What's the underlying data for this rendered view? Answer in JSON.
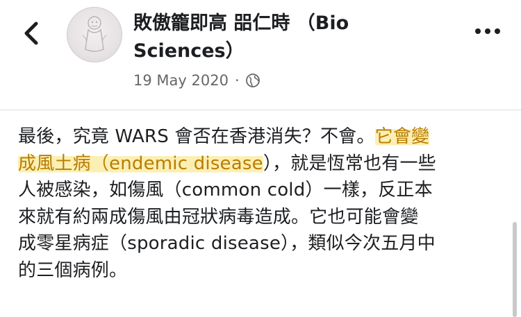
{
  "header": {
    "author_line1": "敗傲籠即高 㗊仁時 （Bio",
    "author_line2": "Sciences）",
    "date": "19 May 2020",
    "separator": "·",
    "back_icon": "chevron-left-icon",
    "globe_icon": "globe-icon",
    "more_icon": "more-horizontal-icon"
  },
  "post": {
    "line1_plain": "最後，究竟 WARS 會否在香港消失？不會。",
    "line1_highlight": "它會變",
    "line2_highlight": "成風土病（endemic disease",
    "line2_plain": "），就是恆常也有一些",
    "line3": "人被感染，如傷風（common cold）一樣，反正本",
    "line4": "來就有約兩成傷風由冠狀病毒造成。它也可能會變",
    "line5": "成零星病症（sporadic disease），類似今次五月中",
    "line6": "的三個病例。"
  },
  "colors": {
    "highlight_bg": "#fcefb4",
    "highlight_text": "#b97d00",
    "meta_text": "#65676b",
    "divider": "#dadde1"
  }
}
